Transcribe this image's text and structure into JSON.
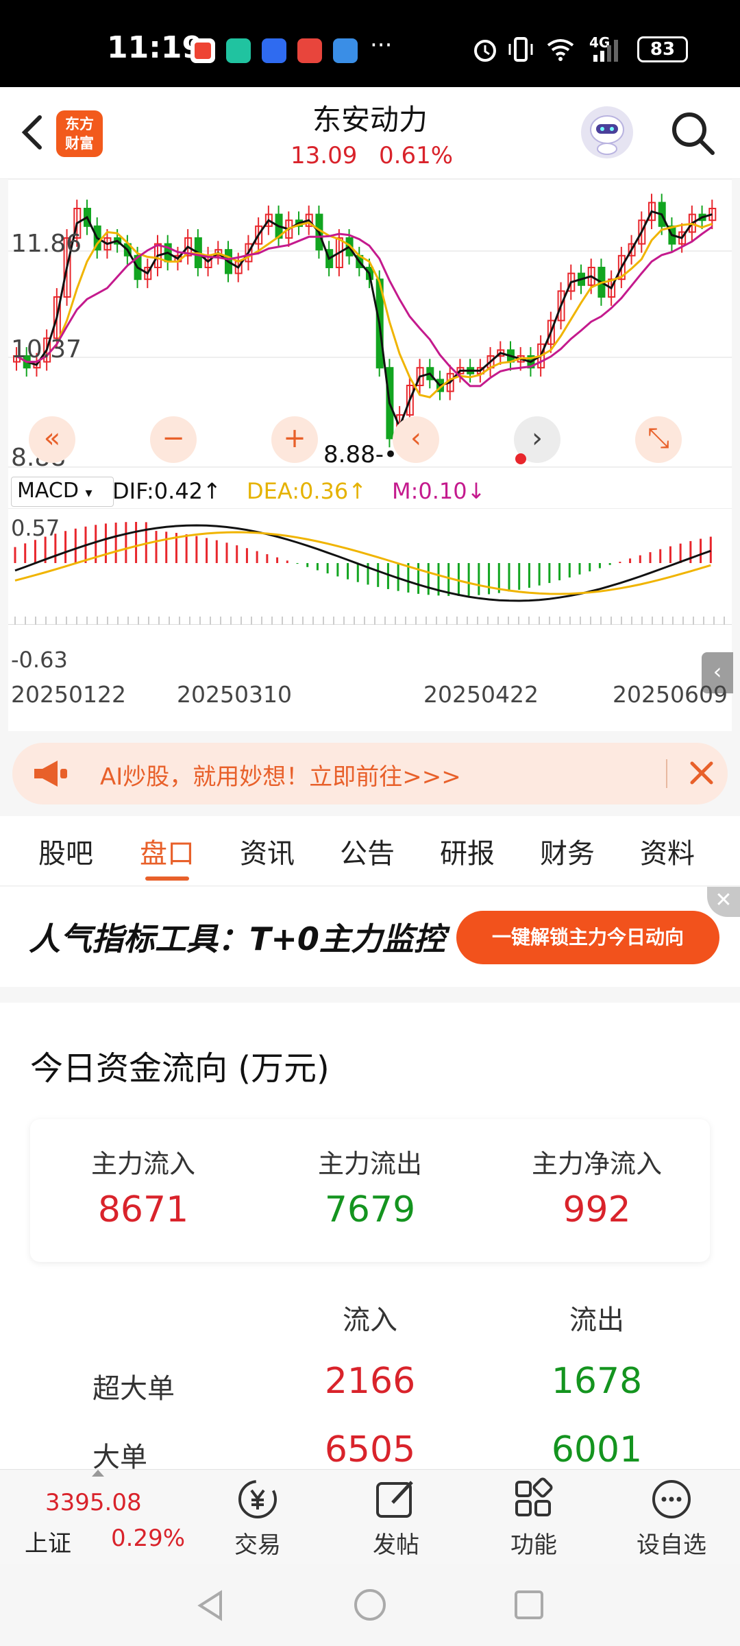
{
  "status_bar": {
    "time": "11:19",
    "more": "···",
    "network": "4G",
    "battery": "83"
  },
  "header": {
    "logo_line1": "东方",
    "logo_line2": "财富",
    "stock_name": "东安动力",
    "price": "13.09",
    "change_pct": "0.61%"
  },
  "kline": {
    "y_labels": [
      "11.86",
      "10.37",
      "8.88"
    ],
    "low_marker": "8.88",
    "buttons": [
      "«",
      "−",
      "+",
      "‹",
      "›",
      "⤡"
    ],
    "colors": {
      "up": "#e8262c",
      "down": "#12a520",
      "ma5": "#111111",
      "ma10": "#f0b400",
      "ma20": "#c41a8d"
    }
  },
  "macd": {
    "selector": "MACD",
    "dif": "DIF:0.42↑",
    "dea": "DEA:0.36↑",
    "m": "M:0.10↓",
    "y_max": "0.57",
    "y_min": "-0.63",
    "dates": [
      "20250122",
      "20250310",
      "20250422",
      "20250609"
    ]
  },
  "ad_banner": {
    "text": "AI炒股，就用妙想！立即前往>>>"
  },
  "tabs": [
    "股吧",
    "盘口",
    "资讯",
    "公告",
    "研报",
    "财务",
    "资料"
  ],
  "active_tab": "盘口",
  "promo": {
    "text": "人气指标工具：T+0主力监控",
    "button": "一键解锁主力今日动向",
    "close": "✕"
  },
  "fund_flow": {
    "title": "今日资金流向 (万元)",
    "summary": [
      {
        "label": "主力流入",
        "value": "8671"
      },
      {
        "label": "主力流出",
        "value": "7679"
      },
      {
        "label": "主力净流入",
        "value": "992"
      }
    ],
    "col_in": "流入",
    "col_out": "流出",
    "rows": [
      {
        "label": "超大单",
        "in": "2166",
        "out": "1678"
      },
      {
        "label": "大单",
        "in": "6505",
        "out": "6001"
      }
    ]
  },
  "bottom_nav": {
    "index_value": "3395.08",
    "index_name": "上证",
    "index_change": "0.29%",
    "items": [
      {
        "label": "交易",
        "icon": "yuan-exchange-icon"
      },
      {
        "label": "发帖",
        "icon": "edit-icon"
      },
      {
        "label": "功能",
        "icon": "grid-icon"
      },
      {
        "label": "设自选",
        "icon": "more-circle-icon"
      }
    ]
  }
}
